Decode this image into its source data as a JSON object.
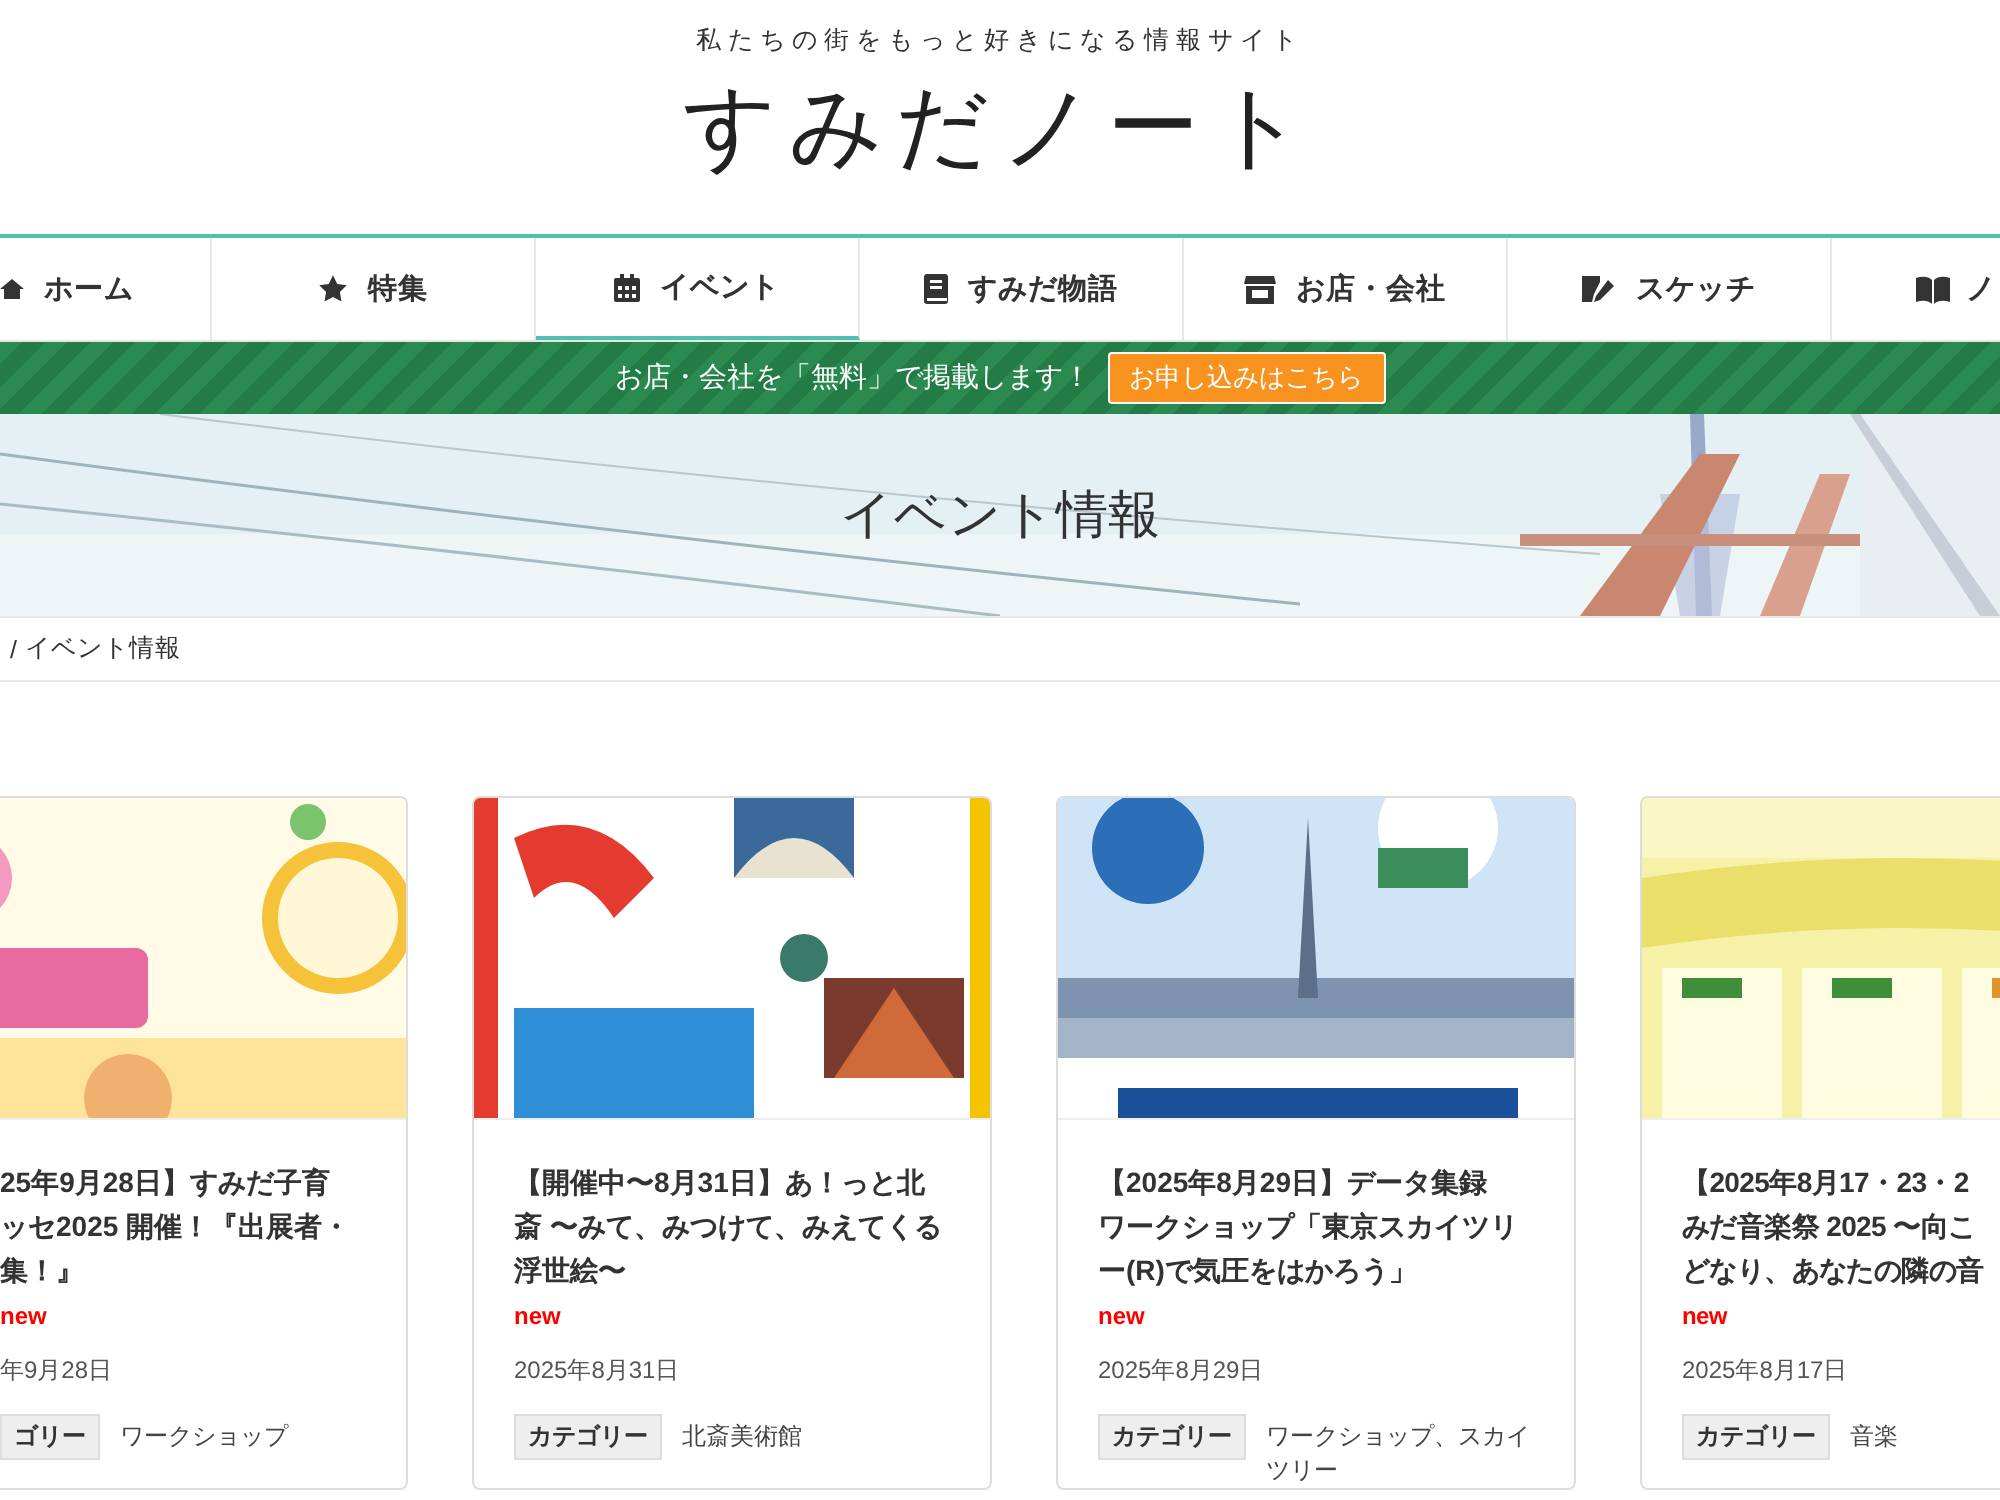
{
  "header": {
    "tagline": "私たちの街をもっと好きになる情報サイト",
    "logo": "すみだノート"
  },
  "nav": [
    {
      "label": "ホーム",
      "selected": false
    },
    {
      "label": "特集",
      "selected": false
    },
    {
      "label": "イベント",
      "selected": true
    },
    {
      "label": "すみだ物語",
      "selected": false
    },
    {
      "label": "お店・会社",
      "selected": false
    },
    {
      "label": "スケッチ",
      "selected": false
    },
    {
      "label": "ノ",
      "selected": false
    }
  ],
  "promo": {
    "text": "お店・会社を「無料」で掲載します！",
    "button": "お申し込みはこちら"
  },
  "hero": {
    "title": "イベント情報"
  },
  "breadcrumb": {
    "separator": "/",
    "current": "イベント情報"
  },
  "cards": [
    {
      "title_lines": [
        "25年9月28日】すみだ子育",
        "ッセ2025 開催！『出展者・",
        "集！』"
      ],
      "badge": "new",
      "date": "年9月28日",
      "category_label": "ゴリー",
      "category": "ワークショップ"
    },
    {
      "title_lines": [
        "【開催中〜8月31日】あ！っと北",
        "斎 〜みて、みつけて、みえてくる",
        "浮世絵〜"
      ],
      "badge": "new",
      "date": "2025年8月31日",
      "category_label": "カテゴリー",
      "category": "北斎美術館"
    },
    {
      "title_lines": [
        "【2025年8月29日】データ集録",
        "ワークショップ「東京スカイツリ",
        "ー(R)で気圧をはかろう」"
      ],
      "badge": "new",
      "date": "2025年8月29日",
      "category_label": "カテゴリー",
      "category": "ワークショップ、スカイツリー"
    },
    {
      "title_lines": [
        "【2025年8月17・23・2",
        "みだ音楽祭 2025 〜向こ",
        "どなり、あなたの隣の音"
      ],
      "badge": "new",
      "date": "2025年8月17日",
      "category_label": "カテゴリー",
      "category": "音楽"
    }
  ]
}
